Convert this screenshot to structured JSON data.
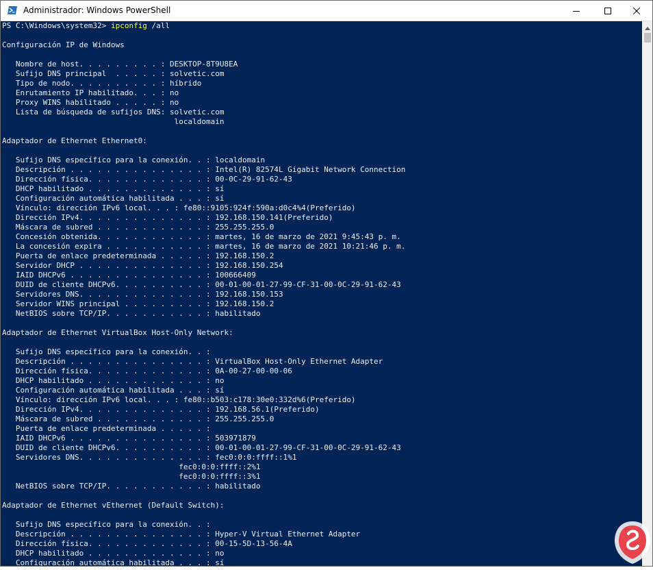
{
  "window": {
    "title": "Administrador: Windows PowerShell",
    "icons": {
      "app": "powershell-icon",
      "minimize": "minimize-icon",
      "maximize": "maximize-icon",
      "close": "close-icon"
    }
  },
  "colors": {
    "console_bg": "#012456",
    "console_text": "#eeedf0",
    "command_text": "#ffff00"
  },
  "console": {
    "prompt": "PS C:\\Windows\\system32> ",
    "command": "ipconfig",
    "args": " /all",
    "lines": [
      "",
      "Configuración IP de Windows",
      "",
      "   Nombre de host. . . . . . . . . : DESKTOP-8T9U8EA",
      "   Sufijo DNS principal  . . . . . : solvetic.com",
      "   Tipo de nodo. . . . . . . . . . : híbrido",
      "   Enrutamiento IP habilitado. . . : no",
      "   Proxy WINS habilitado . . . . . : no",
      "   Lista de búsqueda de sufijos DNS: solvetic.com",
      "                                      localdomain",
      "",
      "Adaptador de Ethernet Ethernet0:",
      "",
      "   Sufijo DNS específico para la conexión. . : localdomain",
      "   Descripción . . . . . . . . . . . . . . . : Intel(R) 82574L Gigabit Network Connection",
      "   Dirección física. . . . . . . . . . . . . : 00-0C-29-91-62-43",
      "   DHCP habilitado . . . . . . . . . . . . . : sí",
      "   Configuración automática habilitada . . . : sí",
      "   Vínculo: dirección IPv6 local. . . : fe80::9105:924f:590a:d0c4%4(Preferido)",
      "   Dirección IPv4. . . . . . . . . . . . . . : 192.168.150.141(Preferido)",
      "   Máscara de subred . . . . . . . . . . . . : 255.255.255.0",
      "   Concesión obtenida. . . . . . . . . . . . : martes, 16 de marzo de 2021 9:45:43 p. m.",
      "   La concesión expira . . . . . . . . . . . : martes, 16 de marzo de 2021 10:21:46 p. m.",
      "   Puerta de enlace predeterminada . . . . . : 192.168.150.2",
      "   Servidor DHCP . . . . . . . . . . . . . . : 192.168.150.254",
      "   IAID DHCPv6 . . . . . . . . . . . . . . . : 100666409",
      "   DUID de cliente DHCPv6. . . . . . . . . . : 00-01-00-01-27-99-CF-31-00-0C-29-91-62-43",
      "   Servidores DNS. . . . . . . . . . . . . . : 192.168.150.153",
      "   Servidor WINS principal . . . . . . . . . : 192.168.150.2",
      "   NetBIOS sobre TCP/IP. . . . . . . . . . . : habilitado",
      "",
      "Adaptador de Ethernet VirtualBox Host-Only Network:",
      "",
      "   Sufijo DNS específico para la conexión. . :",
      "   Descripción . . . . . . . . . . . . . . . : VirtualBox Host-Only Ethernet Adapter",
      "   Dirección física. . . . . . . . . . . . . : 0A-00-27-00-00-06",
      "   DHCP habilitado . . . . . . . . . . . . . : no",
      "   Configuración automática habilitada . . . : sí",
      "   Vínculo: dirección IPv6 local. . . : fe80::b503:c178:30e0:332d%6(Preferido)",
      "   Dirección IPv4. . . . . . . . . . . . . . : 192.168.56.1(Preferido)",
      "   Máscara de subred . . . . . . . . . . . . : 255.255.255.0",
      "   Puerta de enlace predeterminada . . . . . :",
      "   IAID DHCPv6 . . . . . . . . . . . . . . . : 503971879",
      "   DUID de cliente DHCPv6. . . . . . . . . . : 00-01-00-01-27-99-CF-31-00-0C-29-91-62-43",
      "   Servidores DNS. . . . . . . . . . . . . . : fec0:0:0:ffff::1%1",
      "                                       fec0:0:0:ffff::2%1",
      "                                       fec0:0:0:ffff::3%1",
      "   NetBIOS sobre TCP/IP. . . . . . . . . . . : habilitado",
      "",
      "Adaptador de Ethernet vEthernet (Default Switch):",
      "",
      "   Sufijo DNS específico para la conexión. . :",
      "   Descripción . . . . . . . . . . . . . . . : Hyper-V Virtual Ethernet Adapter",
      "   Dirección física. . . . . . . . . . . . . : 00-15-5D-13-56-4A",
      "   DHCP habilitado . . . . . . . . . . . . . : no",
      "   Configuración automática habilitada . . . : sí"
    ]
  }
}
